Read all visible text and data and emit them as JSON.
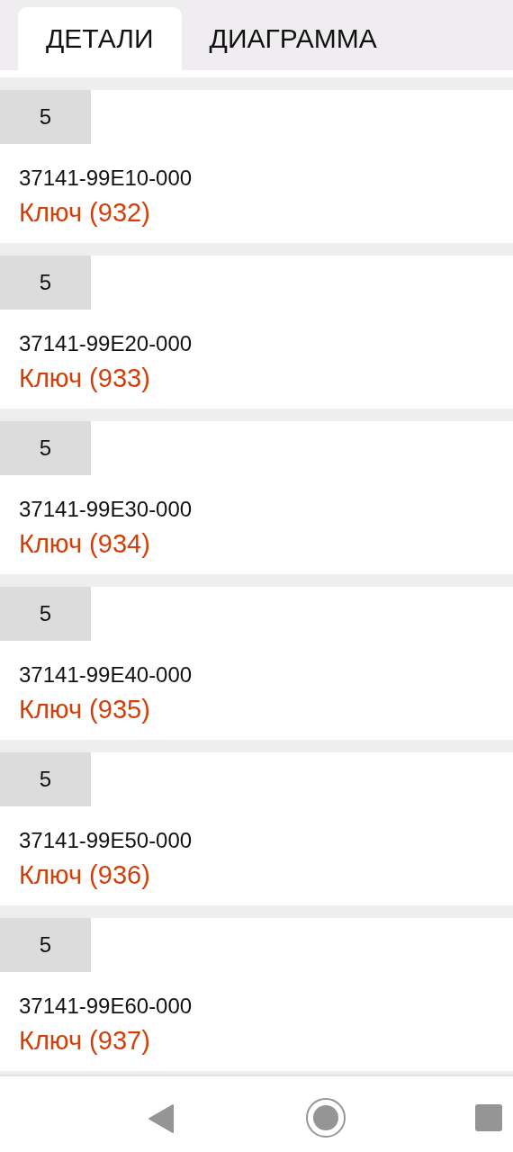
{
  "tabs": [
    {
      "label": "ДЕТАЛИ",
      "selected": true
    },
    {
      "label": "ДИАГРАММА",
      "selected": false
    }
  ],
  "parts": [
    {
      "quantity": "5",
      "code": "37141-99E10-000",
      "name": "Ключ (932)"
    },
    {
      "quantity": "5",
      "code": "37141-99E20-000",
      "name": "Ключ (933)"
    },
    {
      "quantity": "5",
      "code": "37141-99E30-000",
      "name": "Ключ (934)"
    },
    {
      "quantity": "5",
      "code": "37141-99E40-000",
      "name": "Ключ (935)"
    },
    {
      "quantity": "5",
      "code": "37141-99E50-000",
      "name": "Ключ (936)"
    },
    {
      "quantity": "5",
      "code": "37141-99E60-000",
      "name": "Ключ (937)"
    }
  ]
}
